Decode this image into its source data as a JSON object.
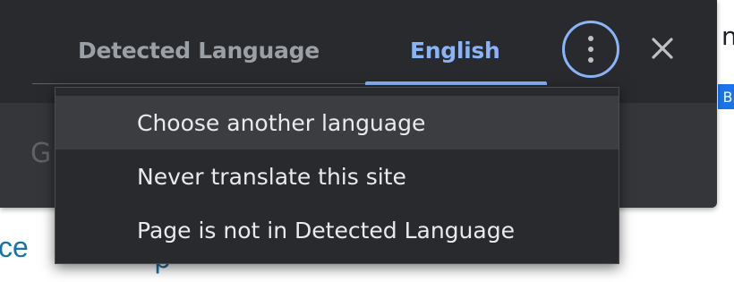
{
  "background_page": {
    "fragment_top_right": "ng",
    "fragment_bottom_left": "ce",
    "fragment_bottom_mid": "p",
    "chip_letter": "B",
    "faded_letter": "G"
  },
  "translate_popup": {
    "tabs": [
      {
        "label": "Detected Language",
        "selected": false
      },
      {
        "label": "English",
        "selected": true
      }
    ],
    "more_options_icon": "vertical-dots-icon",
    "close_icon": "close-icon",
    "accent_color": "#8ab4f8"
  },
  "options_menu": {
    "items": [
      {
        "label": "Choose another language",
        "hovered": true
      },
      {
        "label": "Never translate this site",
        "hovered": false
      },
      {
        "label": "Page is not in Detected Language",
        "hovered": false
      }
    ]
  }
}
